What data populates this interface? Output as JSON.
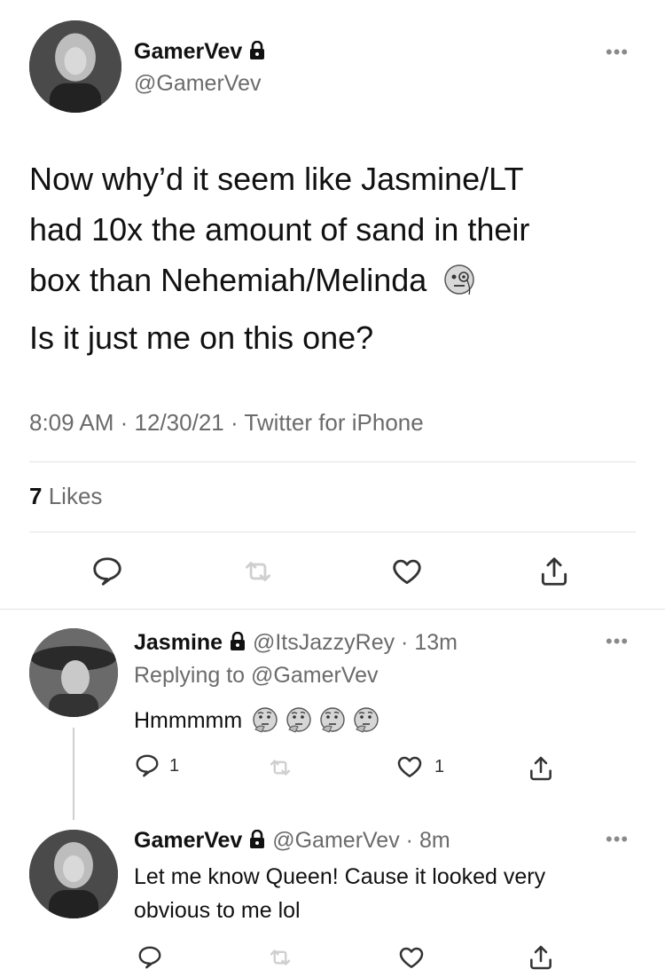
{
  "tweet": {
    "author_name": "GamerVev",
    "author_handle": "@GamerVev",
    "text_line1": "Now why’d it seem like Jasmine/LT",
    "text_line2": "had 10x the amount of sand in their",
    "text_line3": "box than Nehemiah/Melinda",
    "text_line4": "Is it just me on this one?",
    "emoji": "face-with-monocle-icon",
    "time": "8:09 AM",
    "date": "12/30/21",
    "source": "Twitter for iPhone",
    "likes_count": "7",
    "likes_label": "Likes"
  },
  "replies": [
    {
      "author_name": "Jasmine",
      "author_handle": "@ItsJazzyRey",
      "age": "13m",
      "replying_to_label": "Replying to",
      "replying_to_handle": "@GamerVev",
      "text": "Hmmmmm",
      "reply_count": "1",
      "like_count": "1"
    },
    {
      "author_name": "GamerVev",
      "author_handle": "@GamerVev",
      "age": "8m",
      "text_line1": "Let me know Queen! Cause it looked very",
      "text_line2": "obvious to me lol"
    }
  ],
  "colors": {
    "text": "#111111",
    "secondary": "#6b6b6b",
    "divider": "#e3e3e3"
  }
}
